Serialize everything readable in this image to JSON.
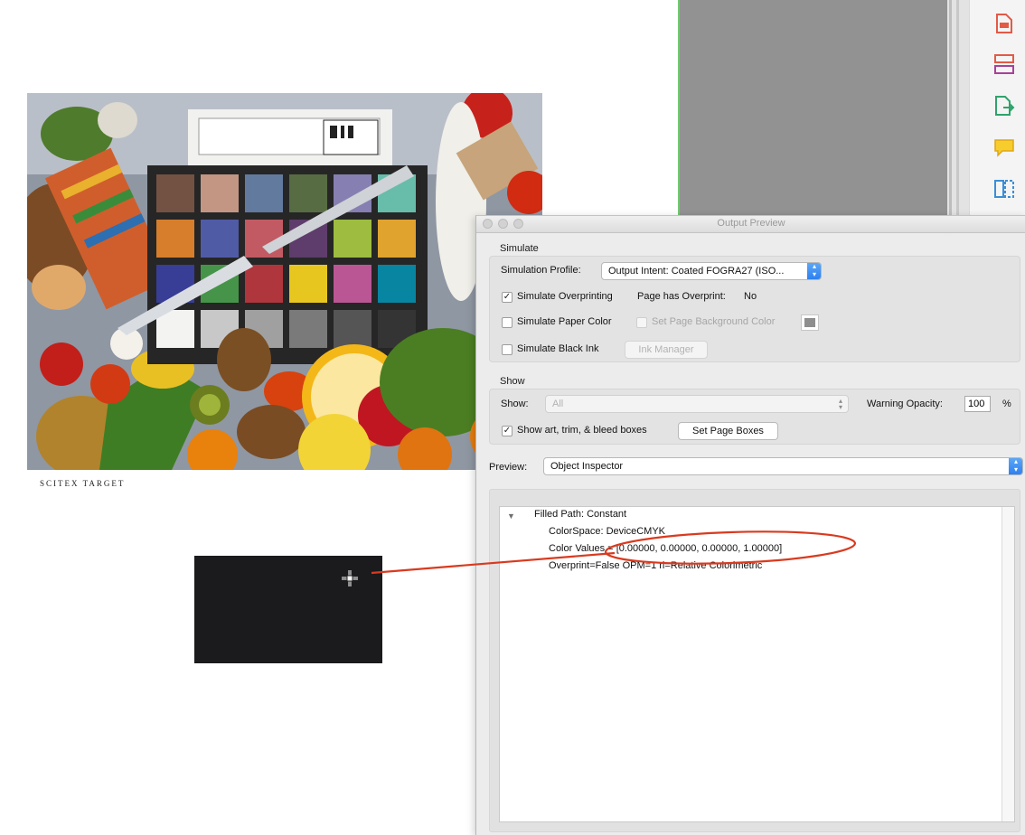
{
  "document": {
    "caption": "SCITEX TARGET",
    "photo_label": "ColorChecker Color Rendition Chart"
  },
  "dialog": {
    "title": "Output Preview",
    "simulate": {
      "section_label": "Simulate",
      "profile_label": "Simulation Profile:",
      "profile_value": "Output Intent: Coated FOGRA27 (ISO...",
      "simulate_overprinting": {
        "label": "Simulate Overprinting",
        "checked": true
      },
      "page_has_overprint_label": "Page has Overprint:",
      "page_has_overprint_value": "No",
      "simulate_paper_color": {
        "label": "Simulate Paper Color",
        "checked": false
      },
      "set_page_background": {
        "label": "Set Page Background Color",
        "checked": false,
        "enabled": false
      },
      "background_swatch_color": "#8e8e8e",
      "simulate_black_ink": {
        "label": "Simulate Black Ink",
        "checked": false
      },
      "ink_manager_label": "Ink Manager"
    },
    "show": {
      "section_label": "Show",
      "show_label": "Show:",
      "show_value": "All",
      "warning_opacity_label": "Warning Opacity:",
      "warning_opacity_value": "100",
      "percent_symbol": "%",
      "show_boxes": {
        "label": "Show art, trim, & bleed boxes",
        "checked": true
      },
      "set_page_boxes_label": "Set Page Boxes"
    },
    "preview": {
      "label": "Preview:",
      "value": "Object Inspector"
    },
    "inspector": {
      "title": "Filled Path: Constant",
      "lines": [
        "ColorSpace: DeviceCMYK",
        "Color Values = [0.00000, 0.00000, 0.00000, 1.00000]",
        "Overprint=False OPM=1 ri=Relative Colorimetric"
      ]
    }
  },
  "checkmark": "✓",
  "colors": {
    "annotation": "#d93a1f",
    "accent_blue": "#2a7ef0",
    "black_patch": "#1b1a1c",
    "gray_canvas": "#929292"
  },
  "tool_icons": [
    "create-pdf-icon",
    "organize-pages-icon",
    "export-pdf-icon",
    "comment-icon",
    "compare-icon"
  ]
}
